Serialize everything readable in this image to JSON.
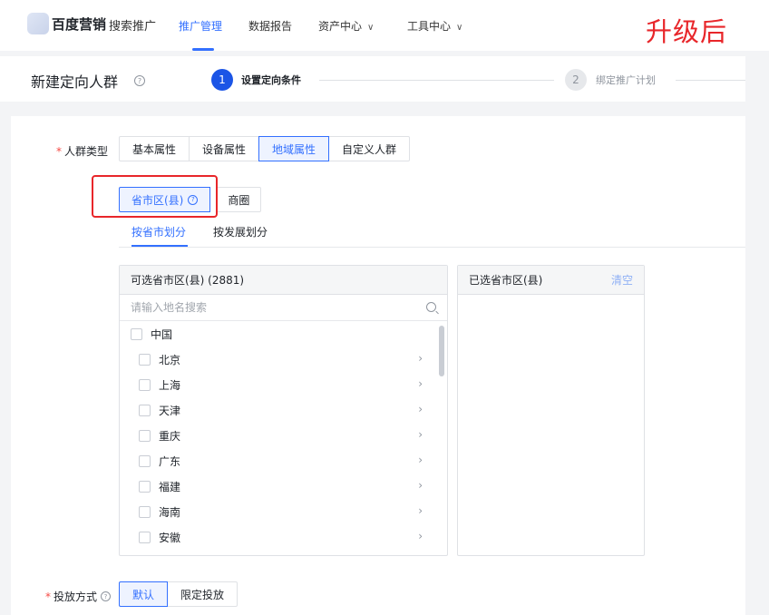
{
  "nav": {
    "brand": "百度营销",
    "product": "搜索推广",
    "items": [
      {
        "label": "推广管理",
        "active": true,
        "dropdown": false
      },
      {
        "label": "数据报告",
        "active": false,
        "dropdown": false
      },
      {
        "label": "资产中心",
        "active": false,
        "dropdown": true
      },
      {
        "label": "工具中心",
        "active": false,
        "dropdown": true
      }
    ],
    "annotation": "升级后"
  },
  "header": {
    "title": "新建定向人群",
    "steps": [
      {
        "number": "1",
        "label": "设置定向条件",
        "active": true
      },
      {
        "number": "2",
        "label": "绑定推广计划",
        "active": false
      }
    ]
  },
  "form": {
    "crowd_type": {
      "label": "人群类型",
      "options": [
        "基本属性",
        "设备属性",
        "地域属性",
        "自定义人群"
      ],
      "selected": "地域属性"
    },
    "region_mode": {
      "options": [
        "省市区(县)",
        "商圈"
      ],
      "selected": "省市区(县)"
    },
    "subtabs": {
      "items": [
        "按省市划分",
        "按发展划分"
      ],
      "selected": "按省市划分"
    },
    "available": {
      "title": "可选省市区(县) (2881)",
      "search_placeholder": "请输入地名搜索",
      "root": "中国",
      "regions": [
        "北京",
        "上海",
        "天津",
        "重庆",
        "广东",
        "福建",
        "海南",
        "安徽"
      ]
    },
    "selected_panel": {
      "title": "已选省市区(县)",
      "clear_label": "清空"
    },
    "delivery": {
      "label": "投放方式",
      "options": [
        "默认",
        "限定投放"
      ],
      "selected": "默认"
    }
  },
  "colors": {
    "primary": "#3370ff",
    "annotation_red": "#e8262a",
    "step_active": "#1b55e6"
  }
}
